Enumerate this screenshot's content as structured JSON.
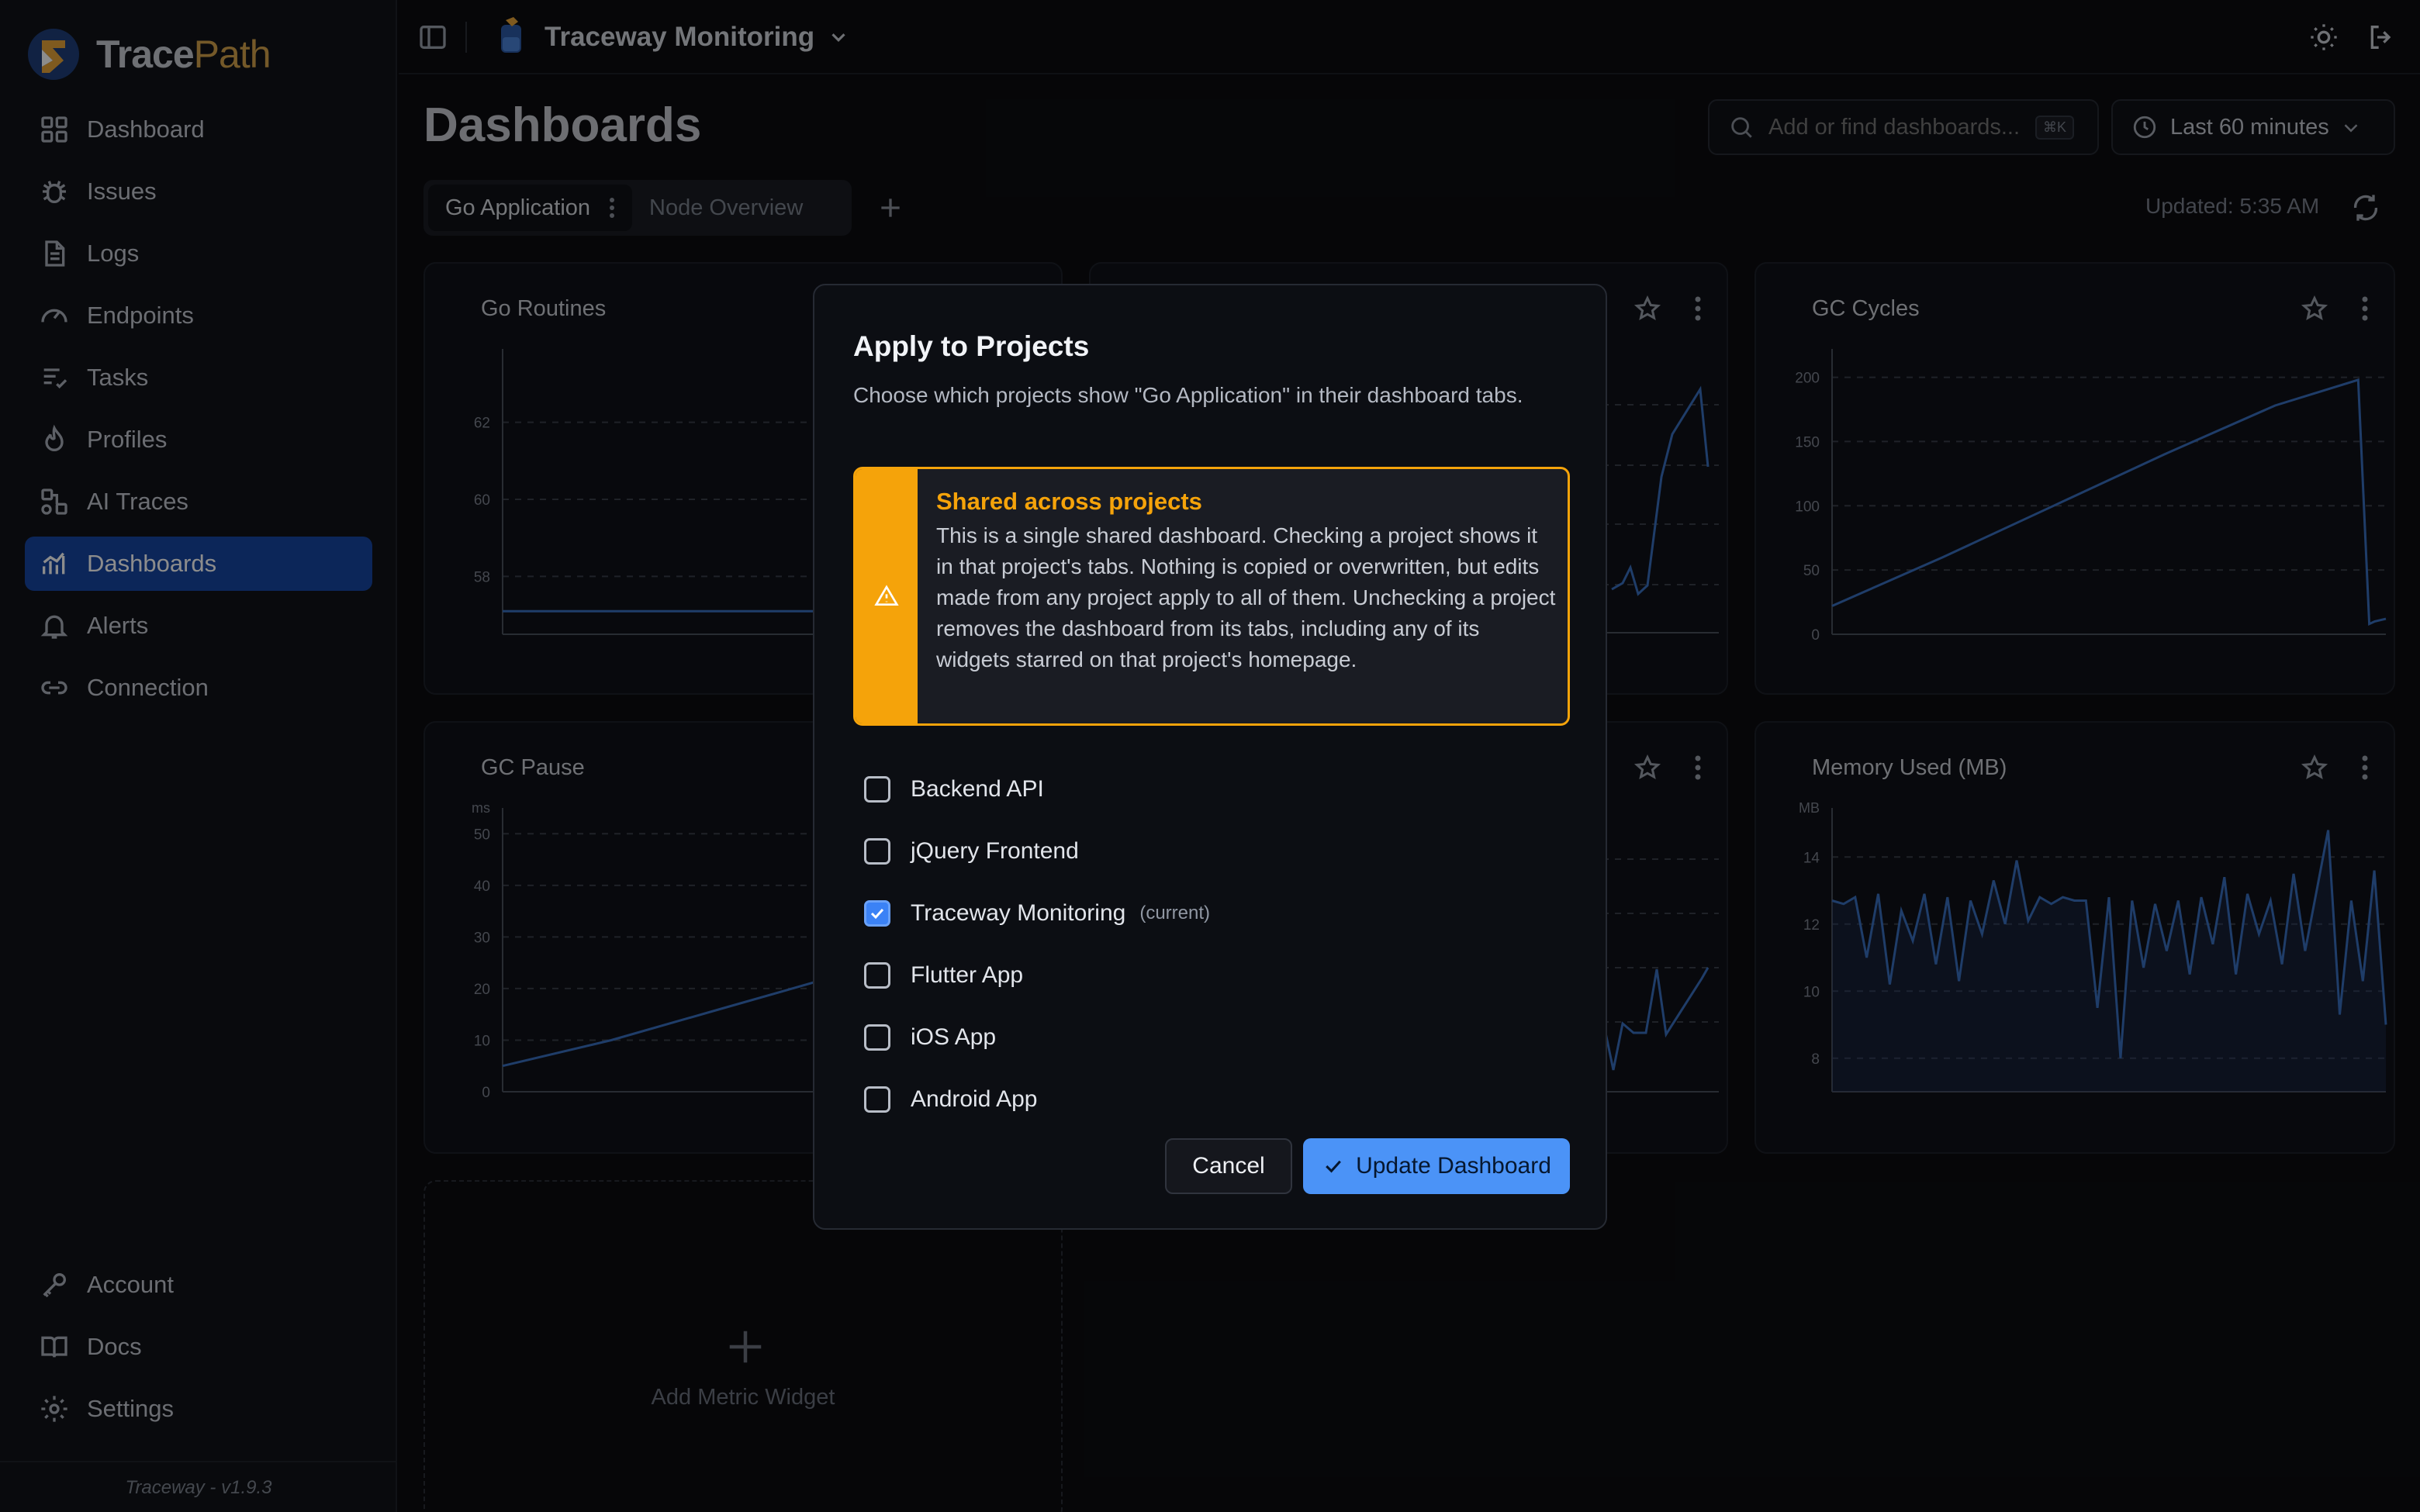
{
  "brand": {
    "name_part1": "Trace",
    "name_part2": "Path"
  },
  "nav": {
    "items": [
      {
        "label": "Dashboard",
        "icon": "grid-icon"
      },
      {
        "label": "Issues",
        "icon": "bug-icon"
      },
      {
        "label": "Logs",
        "icon": "document-icon"
      },
      {
        "label": "Endpoints",
        "icon": "gauge-icon"
      },
      {
        "label": "Tasks",
        "icon": "tasks-icon"
      },
      {
        "label": "Profiles",
        "icon": "flame-icon"
      },
      {
        "label": "AI Traces",
        "icon": "nodes-icon"
      },
      {
        "label": "Dashboards",
        "icon": "chart-icon",
        "active": true
      },
      {
        "label": "Alerts",
        "icon": "bell-icon"
      },
      {
        "label": "Connection",
        "icon": "link-icon"
      }
    ],
    "bottom": [
      {
        "label": "Account",
        "icon": "key-icon"
      },
      {
        "label": "Docs",
        "icon": "book-icon"
      },
      {
        "label": "Settings",
        "icon": "gear-icon"
      }
    ],
    "footer": "Traceway - v1.9.3"
  },
  "topbar": {
    "project_name": "Traceway Monitoring"
  },
  "page": {
    "title": "Dashboards",
    "search_placeholder": "Add or find dashboards...",
    "search_shortcut": "⌘K",
    "time_range": "Last 60 minutes",
    "tabs": [
      "Go Application",
      "Node Overview"
    ],
    "updated": "Updated: 5:35 AM"
  },
  "widgets": {
    "go_routines": {
      "title": "Go Routines"
    },
    "gc_cycles": {
      "title": "GC Cycles"
    },
    "gc_pause": {
      "title": "GC Pause"
    },
    "memory_used": {
      "title": "Memory Used (MB)"
    },
    "add_label": "Add Metric Widget"
  },
  "chart_data": [
    {
      "type": "line",
      "title": "Go Routines",
      "ylim": [
        56.5,
        63.5
      ],
      "yticks": [
        "62",
        "60",
        "58"
      ],
      "x": [
        0,
        1
      ],
      "series": [
        {
          "values": [
            57.1,
            57.1
          ]
        }
      ]
    },
    {
      "type": "line",
      "title": "GC Cycles",
      "ylim": [
        0,
        210
      ],
      "yticks": [
        "200",
        "150",
        "100",
        "50",
        "0"
      ],
      "x": [
        0,
        0.2,
        0.4,
        0.6,
        0.8,
        0.95,
        0.97,
        0.98,
        1
      ],
      "series": [
        {
          "values": [
            22,
            60,
            100,
            140,
            178,
            198,
            8,
            10,
            12
          ]
        }
      ]
    },
    {
      "type": "line",
      "title": "GC Pause",
      "ylim": [
        0,
        52
      ],
      "yticks": [
        "50",
        "40",
        "30",
        "20",
        "10",
        "0"
      ],
      "yunit": "ms",
      "x": [
        0,
        0.2,
        0.4,
        0.6,
        0.8,
        1
      ],
      "series": [
        {
          "values": [
            5,
            10,
            16,
            22,
            27,
            32
          ]
        }
      ]
    },
    {
      "type": "area",
      "title": "Memory Used (MB)",
      "ylim": [
        7,
        15
      ],
      "yticks": [
        "14",
        "12",
        "10",
        "8"
      ],
      "yunit": "MB",
      "series": [
        {
          "values": [
            12.7,
            12.6,
            12.8,
            11,
            12.9,
            10.2,
            12.4,
            11.5,
            12.9,
            10.8,
            12.8,
            10.3,
            12.7,
            11.7,
            13.3,
            12,
            13.9,
            12.1,
            12.8,
            12.6,
            12.8,
            12.7,
            12.7,
            9.5,
            12.8,
            8,
            12.7,
            10.7,
            12.6,
            11.2,
            12.7,
            10.5,
            12.8,
            11.4,
            13.4,
            10.5,
            12.9,
            11.7,
            12.7,
            10.8,
            13.5,
            11.2,
            13.0,
            14.8,
            9.3,
            12.7,
            10.3,
            13.6,
            9.0
          ]
        }
      ]
    }
  ],
  "modal": {
    "title": "Apply to Projects",
    "description": "Choose which projects show \"Go Application\" in their dashboard tabs.",
    "warning_title": "Shared across projects",
    "warning_text": "This is a single shared dashboard. Checking a project shows it in that project's tabs. Nothing is copied or overwritten, but edits made from any project apply to all of them. Unchecking a project removes the dashboard from its tabs, including any of its widgets starred on that project's homepage.",
    "options": [
      {
        "label": "Backend API",
        "checked": false
      },
      {
        "label": "jQuery Frontend",
        "checked": false
      },
      {
        "label": "Traceway Monitoring",
        "checked": true,
        "note": "(current)"
      },
      {
        "label": "Flutter App",
        "checked": false
      },
      {
        "label": "iOS App",
        "checked": false
      },
      {
        "label": "Android App",
        "checked": false
      }
    ],
    "cancel_label": "Cancel",
    "update_label": "Update Dashboard"
  },
  "colors": {
    "accent": "#3b82f6",
    "warning": "#f5a30a",
    "active_nav": "#1746a2",
    "line": "#3a6fc0"
  }
}
